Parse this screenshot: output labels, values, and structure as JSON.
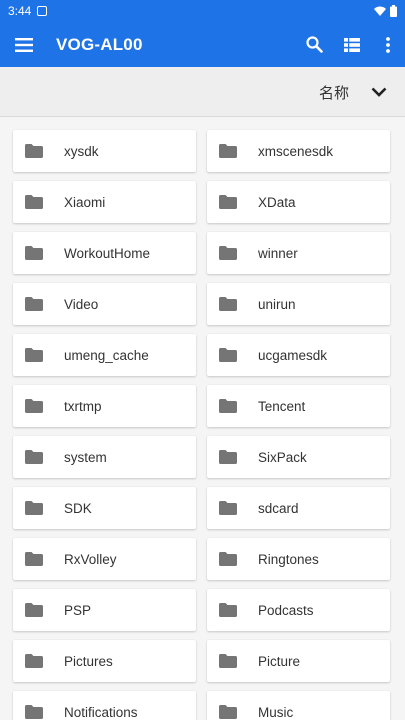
{
  "status_bar": {
    "time": "3:44"
  },
  "app_bar": {
    "title": "VOG-AL00"
  },
  "sort": {
    "label": "名称"
  },
  "colors": {
    "primary": "#1e73e6",
    "folder": "#757575",
    "tile": "#ffffff",
    "background": "#f5f5f5"
  },
  "folders": [
    "xysdk",
    "xmscenesdk",
    "Xiaomi",
    "XData",
    "WorkoutHome",
    "winner",
    "Video",
    "unirun",
    "umeng_cache",
    "ucgamesdk",
    "txrtmp",
    "Tencent",
    "system",
    "SixPack",
    "SDK",
    "sdcard",
    "RxVolley",
    "Ringtones",
    "PSP",
    "Podcasts",
    "Pictures",
    "Picture",
    "Notifications",
    "Music"
  ]
}
